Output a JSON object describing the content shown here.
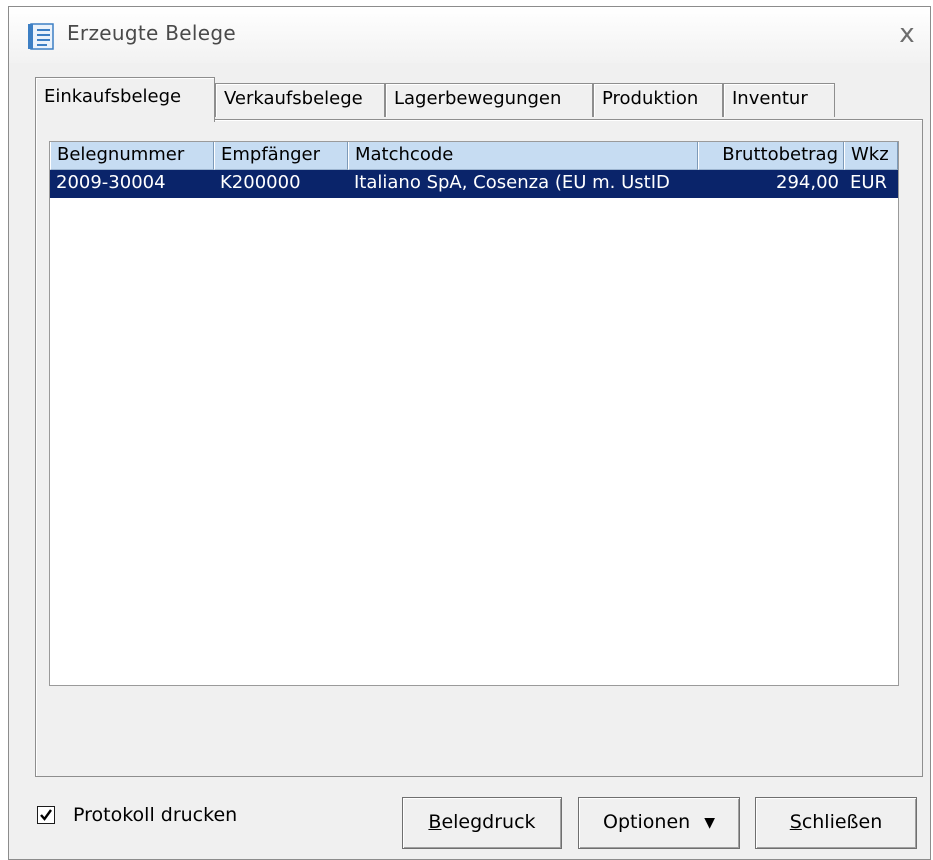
{
  "window": {
    "title": "Erzeugte Belege",
    "title_icon": "document-list-icon",
    "close_icon": "close-icon",
    "close_glyph": "x"
  },
  "tabs": [
    {
      "label": "Einkaufsbelege",
      "active": true
    },
    {
      "label": "Verkaufsbelege",
      "active": false
    },
    {
      "label": "Lagerbewegungen",
      "active": false
    },
    {
      "label": "Produktion",
      "active": false
    },
    {
      "label": "Inventur",
      "active": false
    }
  ],
  "list": {
    "columns": [
      "Belegnummer",
      "Empfänger",
      "Matchcode",
      "Bruttobetrag",
      "Wkz"
    ],
    "rows": [
      {
        "belegnummer": "2009-30004",
        "empfaenger": "K200000",
        "matchcode": "Italiano SpA, Cosenza (EU m. UstID",
        "bruttobetrag": "294,00",
        "wkz": "EUR",
        "selected": true
      }
    ],
    "colors": {
      "header": "#c6dcf2",
      "selection": "#0a246a"
    }
  },
  "footer": {
    "checkbox_label": "Protokoll drucken",
    "checkbox_checked": true,
    "buttons": {
      "belegdruck": {
        "mnemonic": "B",
        "rest": "elegdruck"
      },
      "optionen": {
        "label": "Optionen",
        "icon": "dropdown-arrow-icon"
      },
      "schliessen": {
        "mnemonic": "S",
        "rest": "chließen"
      }
    }
  }
}
